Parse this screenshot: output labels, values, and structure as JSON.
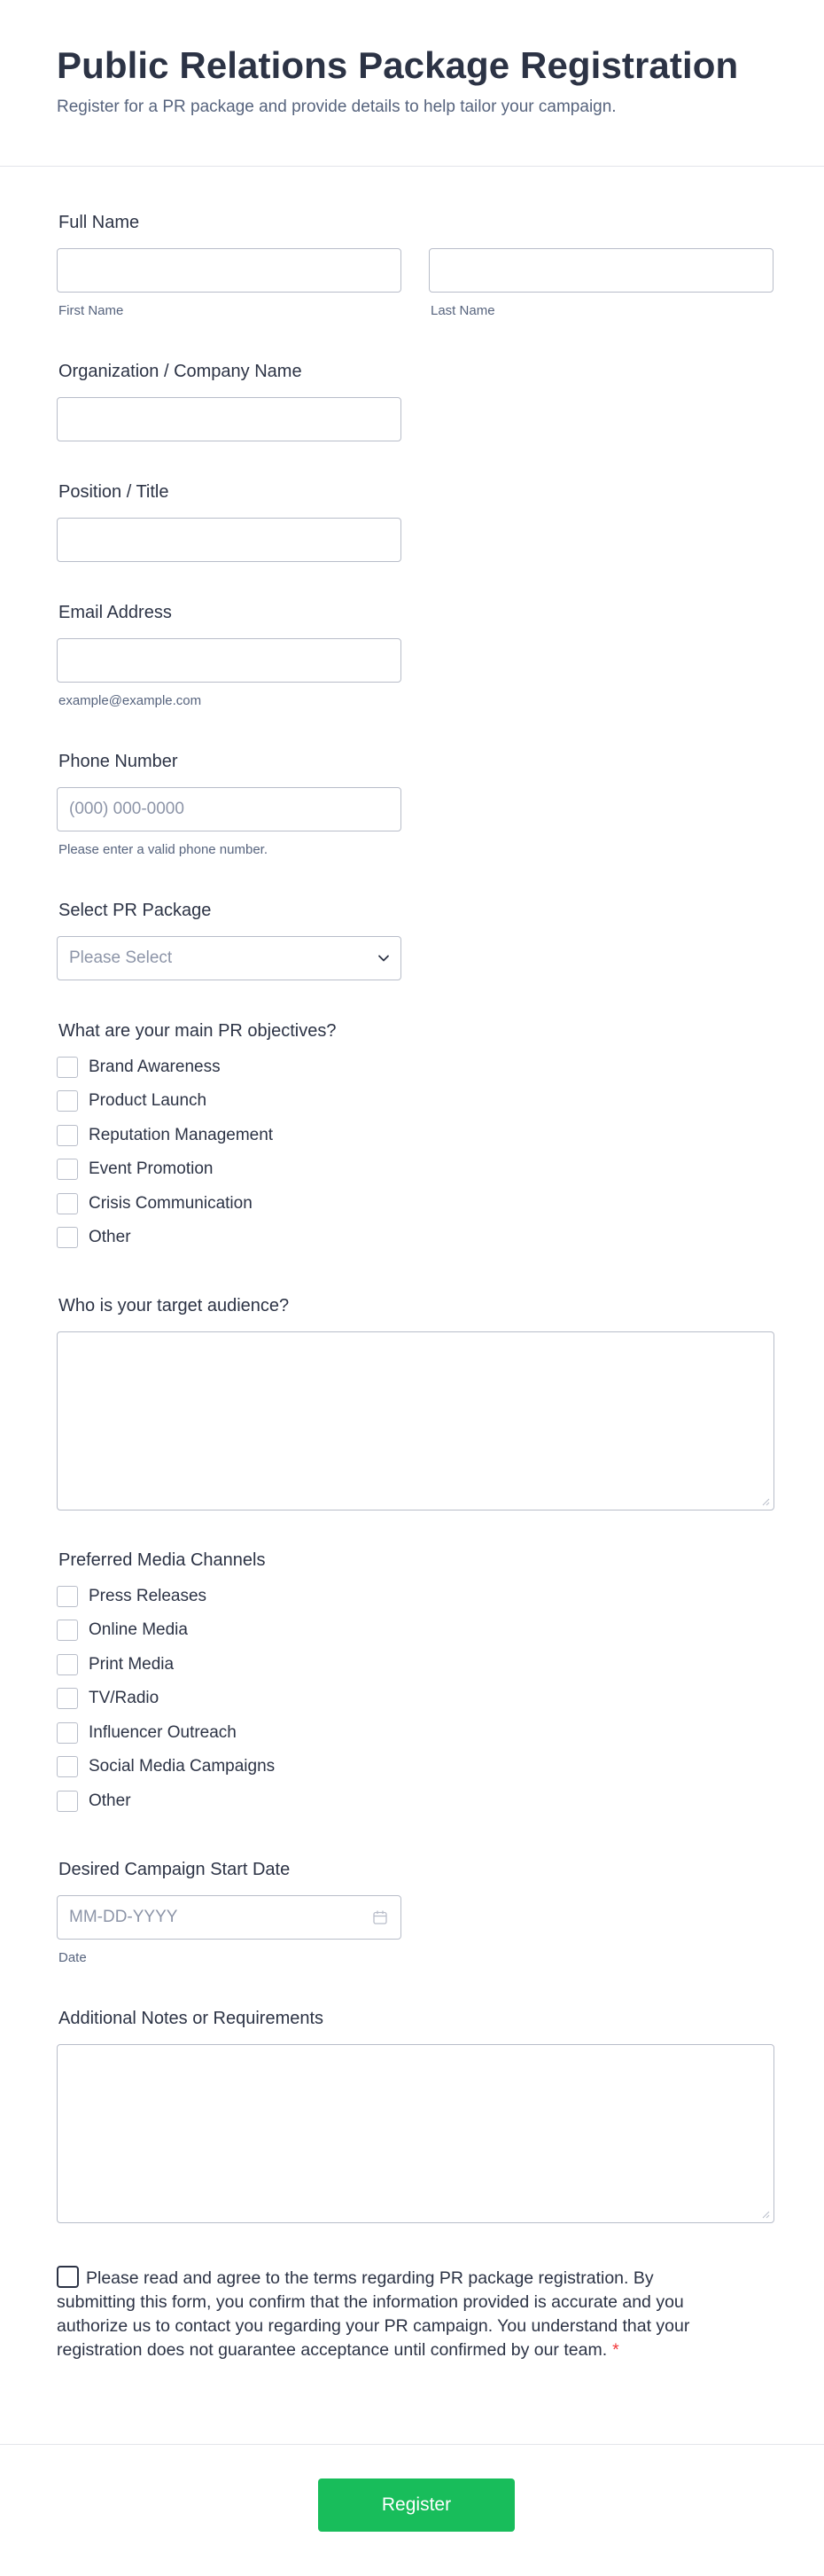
{
  "header": {
    "title": "Public Relations Package Registration",
    "subtitle": "Register for a PR package and provide details to help tailor your campaign."
  },
  "full_name": {
    "label": "Full Name",
    "first_sublabel": "First Name",
    "last_sublabel": "Last Name",
    "first_value": "",
    "last_value": ""
  },
  "organization": {
    "label": "Organization / Company Name",
    "value": ""
  },
  "position": {
    "label": "Position / Title",
    "value": ""
  },
  "email": {
    "label": "Email Address",
    "value": "",
    "sublabel": "example@example.com"
  },
  "phone": {
    "label": "Phone Number",
    "placeholder": "(000) 000-0000",
    "sublabel": "Please enter a valid phone number."
  },
  "package": {
    "label": "Select PR Package",
    "selected": "Please Select",
    "icon": "chevron-down-icon"
  },
  "objectives": {
    "label": "What are your main PR objectives?",
    "options": [
      "Brand Awareness",
      "Product Launch",
      "Reputation Management",
      "Event Promotion",
      "Crisis Communication",
      "Other"
    ]
  },
  "audience": {
    "label": "Who is your target audience?",
    "value": ""
  },
  "media": {
    "label": "Preferred Media Channels",
    "options": [
      "Press Releases",
      "Online Media",
      "Print Media",
      "TV/Radio",
      "Influencer Outreach",
      "Social Media Campaigns",
      "Other"
    ]
  },
  "start_date": {
    "label": "Desired Campaign Start Date",
    "placeholder": "MM-DD-YYYY",
    "sublabel": "Date",
    "icon": "calendar-icon"
  },
  "notes": {
    "label": "Additional Notes or Requirements",
    "value": ""
  },
  "terms": {
    "text": "Please read and agree to the terms regarding PR package registration. By submitting this form, you confirm that the information provided is accurate and you authorize us to contact you regarding your PR campaign. You understand that your registration does not guarantee acceptance until confirmed by our team.",
    "required_mark": "*"
  },
  "submit": {
    "label": "Register"
  },
  "colors": {
    "text": "#2c3345",
    "muted": "#57647e",
    "border": "#b8bdc9",
    "submit": "#18bd5b",
    "required": "#f23a3c"
  }
}
